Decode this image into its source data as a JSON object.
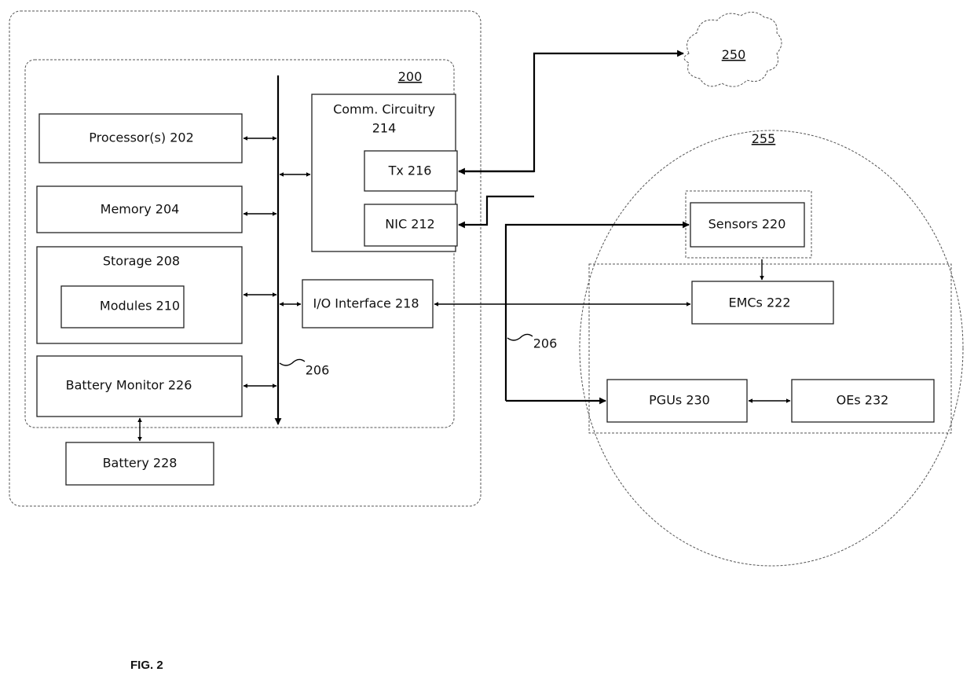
{
  "figure": {
    "caption": "FIG. 2",
    "device_ref": "200",
    "network_ref": "250",
    "environment_ref": "255",
    "bus_label_left": "206",
    "bus_label_right": "206"
  },
  "components": {
    "processor": "Processor(s) 202",
    "memory": "Memory 204",
    "storage": "Storage 208",
    "modules": "Modules 210",
    "battery_monitor": "Battery Monitor 226",
    "battery": "Battery 228",
    "comm_circuitry_line1": "Comm. Circuitry",
    "comm_circuitry_line2": "214",
    "tx": "Tx 216",
    "nic": "NIC 212",
    "io_interface": "I/O Interface 218",
    "sensors": "Sensors 220",
    "emcs": "EMCs 222",
    "pgus": "PGUs 230",
    "oes": "OEs 232"
  }
}
